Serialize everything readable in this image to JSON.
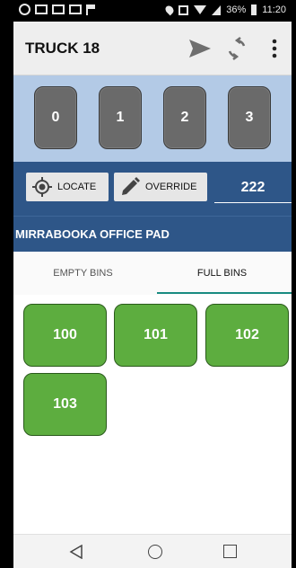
{
  "status_bar": {
    "battery": "36%",
    "time": "11:20",
    "icons": [
      "notification-circle-icon",
      "mail-icon",
      "mail-icon",
      "mail-icon",
      "flag-icon",
      "location-pin-icon",
      "nfc-icon",
      "wifi-icon",
      "signal-icon",
      "battery-icon"
    ]
  },
  "app_bar": {
    "title": "TRUCK 18",
    "icons": [
      "send-icon",
      "sync-icon",
      "more-vert-icon"
    ]
  },
  "bin_numbers": [
    "0",
    "1",
    "2",
    "3"
  ],
  "controls": {
    "locate_label": "LOCATE",
    "override_label": "OVERRIDE",
    "count_value": "222"
  },
  "site": {
    "name": "MIRRABOOKA OFFICE PAD"
  },
  "tabs": {
    "empty_label": "EMPTY BINS",
    "full_label": "FULL BINS",
    "active": "full"
  },
  "full_bins": [
    "100",
    "101",
    "102",
    "103"
  ],
  "colors": {
    "app_bar_bg": "#eeeeee",
    "bin_strip_bg": "#b3cae6",
    "control_bar_bg": "#2e5688",
    "number_button": "#6a6a6a",
    "bin_button": "#5dad3f",
    "tab_indicator": "#1a8c82"
  }
}
